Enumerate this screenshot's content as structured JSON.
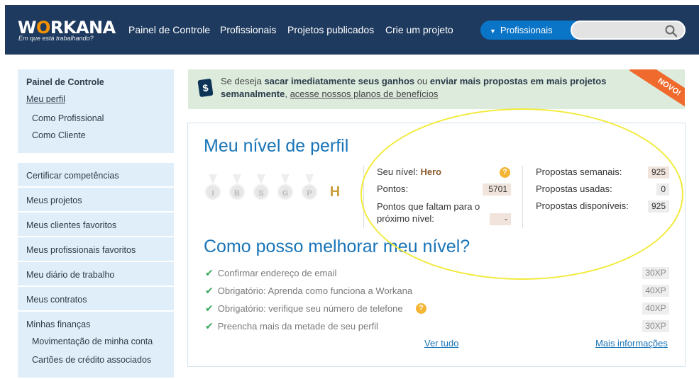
{
  "header": {
    "logo_text": "WORKANA",
    "tagline": "Em que está trabalhando?",
    "nav": [
      "Painel de Controle",
      "Profissionais",
      "Projetos publicados",
      "Crie um projeto"
    ],
    "dropdown_label": "Profissionais",
    "search_placeholder": ""
  },
  "sidebar": {
    "title": "Painel de Controle",
    "meu_perfil": "Meu perfil",
    "perfil_sub": [
      "Como Profissional",
      "Como Cliente"
    ],
    "items": [
      "Certificar competências",
      "Meus projetos",
      "Meus clientes favoritos",
      "Meus profissionais favoritos",
      "Meu diário de trabalho",
      "Meus contratos",
      "Minhas finanças"
    ],
    "financas_sub": [
      "Movimentação de minha conta",
      "Cartões de crédito associados"
    ]
  },
  "banner": {
    "t1": "Se deseja ",
    "b1": "sacar imediatamente seus ganhos",
    "t2": " ou ",
    "b2": "enviar mais propostas em mais projetos semanalmente",
    "t3": ", ",
    "link": "acesse nossos planos de benefícios",
    "ribbon": "NOVO!"
  },
  "level": {
    "title": "Meu nível de perfil",
    "badges": [
      "I",
      "B",
      "S",
      "G",
      "P"
    ],
    "trophy": "H",
    "nivel_label": "Seu nível:",
    "nivel_value": "Hero",
    "pontos_label": "Pontos:",
    "pontos_value": "5701",
    "faltam_label_1": "Pontos que faltam para o",
    "faltam_label_2": "próximo nível:",
    "faltam_value": "-",
    "semanais_label": "Propostas semanais:",
    "semanais_value": "925",
    "usadas_label": "Propostas usadas:",
    "usadas_value": "0",
    "disponiveis_label": "Propostas disponíveis:",
    "disponiveis_value": "925"
  },
  "improve": {
    "title": "Como posso melhorar meu nível?",
    "tasks": [
      {
        "label": "Confirmar endereço de email",
        "xp": "30XP"
      },
      {
        "label": "Obrigatório: Aprenda como funciona a Workana",
        "xp": "40XP"
      },
      {
        "label": "Obrigatório: verifique seu número de telefone",
        "xp": "40XP"
      },
      {
        "label": "Preencha mais da metade de seu perfil",
        "xp": "30XP"
      }
    ],
    "ver_tudo": "Ver tudo",
    "mais_info": "Mais informações"
  },
  "colors": {
    "header_bg": "#1e3a5f",
    "accent_blue": "#1874b8",
    "dropdown_blue": "#0a74c7",
    "logo_o": "#f39200",
    "ribbon": "#f06a2d",
    "annotation_ellipse": "#f2ea3a"
  }
}
